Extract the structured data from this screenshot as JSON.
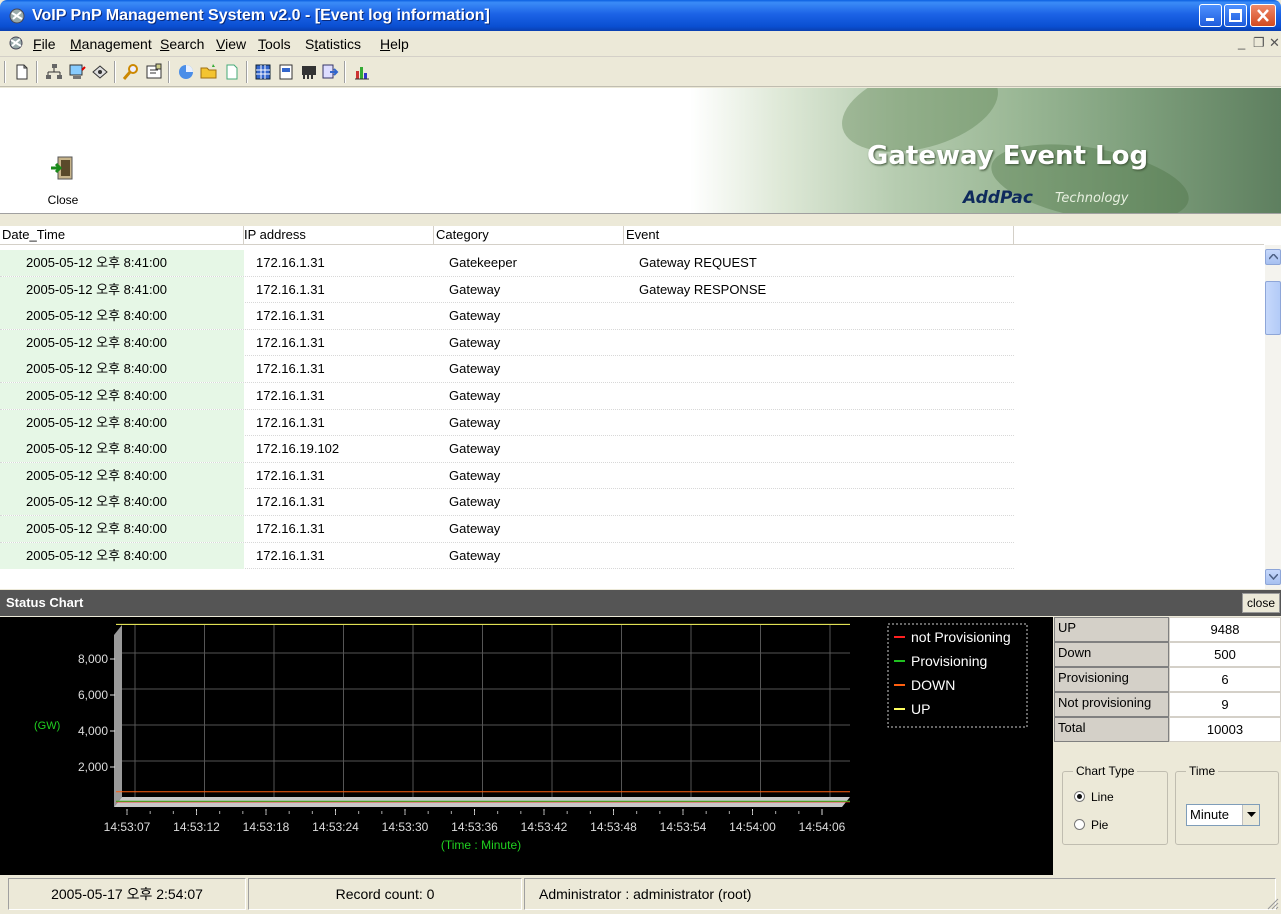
{
  "window": {
    "title": "VoIP PnP Management System v2.0 - [Event log information]"
  },
  "menu": [
    {
      "label": "File",
      "key": "F"
    },
    {
      "label": "Management",
      "key": "M"
    },
    {
      "label": "Search",
      "key": "S"
    },
    {
      "label": "View",
      "key": "V"
    },
    {
      "label": "Tools",
      "key": "T"
    },
    {
      "label": "Statistics",
      "key": "t"
    },
    {
      "label": "Help",
      "key": "H"
    }
  ],
  "toolbar_icons": [
    "new-icon",
    "network-icon",
    "monitor-icon",
    "device-icon",
    "search-icon",
    "properties-icon",
    "pie-icon",
    "folder-open-icon",
    "document-icon",
    "grid-icon",
    "report-icon",
    "chip-icon",
    "export-icon",
    "chart-icon"
  ],
  "close_tool": {
    "label": "Close"
  },
  "banner": {
    "title": "Gateway Event Log",
    "brand": "AddPac",
    "brand_suffix": "Technology"
  },
  "table": {
    "columns": [
      "Date_Time",
      "IP address",
      "Category",
      "Event"
    ],
    "rows": [
      [
        "2005-05-12 오후 8:41:00",
        "172.16.1.31",
        "Gatekeeper",
        "Gateway REQUEST"
      ],
      [
        "2005-05-12 오후 8:41:00",
        "172.16.1.31",
        "Gateway",
        "Gateway RESPONSE"
      ],
      [
        "2005-05-12 오후 8:40:00",
        "172.16.1.31",
        "Gateway",
        ""
      ],
      [
        "2005-05-12 오후 8:40:00",
        "172.16.1.31",
        "Gateway",
        ""
      ],
      [
        "2005-05-12 오후 8:40:00",
        "172.16.1.31",
        "Gateway",
        ""
      ],
      [
        "2005-05-12 오후 8:40:00",
        "172.16.1.31",
        "Gateway",
        ""
      ],
      [
        "2005-05-12 오후 8:40:00",
        "172.16.1.31",
        "Gateway",
        ""
      ],
      [
        "2005-05-12 오후 8:40:00",
        "172.16.19.102",
        "Gateway",
        ""
      ],
      [
        "2005-05-12 오후 8:40:00",
        "172.16.1.31",
        "Gateway",
        ""
      ],
      [
        "2005-05-12 오후 8:40:00",
        "172.16.1.31",
        "Gateway",
        ""
      ],
      [
        "2005-05-12 오후 8:40:00",
        "172.16.1.31",
        "Gateway",
        ""
      ],
      [
        "2005-05-12 오후 8:40:00",
        "172.16.1.31",
        "Gateway",
        ""
      ]
    ]
  },
  "status_chart": {
    "header": "Status Chart",
    "close_label": "close"
  },
  "chart_data": {
    "type": "line",
    "x": [
      "14:53:07",
      "14:53:12",
      "14:53:18",
      "14:53:24",
      "14:53:30",
      "14:53:36",
      "14:53:42",
      "14:53:48",
      "14:53:54",
      "14:54:00",
      "14:54:06"
    ],
    "xlabel": "(Time : Minute)",
    "ylabel": "(GW)",
    "yticks": [
      "2,000",
      "4,000",
      "6,000",
      "8,000"
    ],
    "ylim": [
      0,
      10000
    ],
    "grid": true,
    "legend_position": "top-right",
    "series": [
      {
        "name": "not Provisioning",
        "color": "#ff2020",
        "values": [
          9,
          9,
          9,
          9,
          9,
          9,
          9,
          9,
          9,
          9,
          9
        ]
      },
      {
        "name": "Provisioning",
        "color": "#20c020",
        "values": [
          6,
          6,
          6,
          6,
          6,
          6,
          6,
          6,
          6,
          6,
          6
        ]
      },
      {
        "name": "DOWN",
        "color": "#ff6010",
        "values": [
          500,
          500,
          500,
          500,
          500,
          500,
          500,
          500,
          500,
          500,
          500
        ]
      },
      {
        "name": "UP",
        "color": "#ffff60",
        "values": [
          9488,
          9488,
          9488,
          9488,
          9488,
          9488,
          9488,
          9488,
          9488,
          9488,
          9488
        ]
      }
    ]
  },
  "stats": [
    {
      "label": "UP",
      "value": "9488"
    },
    {
      "label": "Down",
      "value": "500"
    },
    {
      "label": "Provisioning",
      "value": "6"
    },
    {
      "label": "Not provisioning",
      "value": "9"
    },
    {
      "label": "Total",
      "value": "10003"
    }
  ],
  "chart_type": {
    "label": "Chart Type",
    "options": [
      "Line",
      "Pie"
    ],
    "selected": "Line"
  },
  "time": {
    "label": "Time",
    "value": "Minute"
  },
  "statusbar": {
    "datetime": "2005-05-17 오후 2:54:07",
    "record_count": "Record count: 0",
    "user": "Administrator : administrator (root)"
  }
}
